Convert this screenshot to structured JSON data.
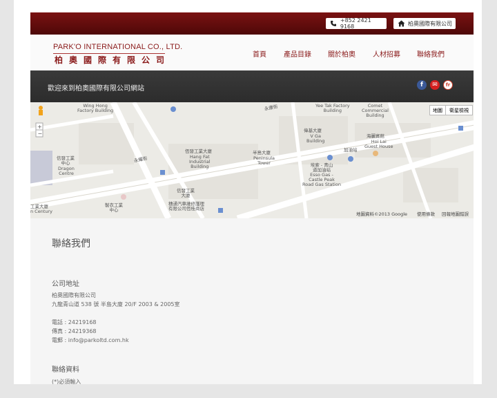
{
  "topbar": {
    "phone": "+852 2421 9168",
    "company": "柏奧國際有限公司",
    "phone_icon": "phone-icon",
    "home_icon": "home-icon"
  },
  "header": {
    "logo_en": "PARK'O INTERNATIONAL CO., LTD.",
    "logo_zh": "柏奧國際有限公司",
    "nav": [
      "首頁",
      "產品目錄",
      "關於柏奧",
      "人材招募",
      "聯絡我們"
    ]
  },
  "band": {
    "welcome": "歡迎來到柏奧國際有限公司網站",
    "social": [
      "f",
      "✉",
      "fr"
    ]
  },
  "map": {
    "type_map": "地圖",
    "type_sat": "衛星檢視",
    "street_main": "永耀街",
    "street_top": "永康街",
    "labels": {
      "wing_hong": "Wing Hong\nFactory Building",
      "hang_fat_zh": "恆發工業大廈",
      "hang_fat": "Hang Fat\nIndustrial\nBuilding",
      "peninsula_zh": "半島大廈",
      "peninsula": "Peninsula\nTower",
      "dragon_zh": "信發工業\n中心",
      "dragon": "Dragon\nCentre",
      "yee_tak": "Yee Tak Factory\nBuilding",
      "comet": "Comet\nCommercial\nBuilding",
      "vgo_zh": "偉基大廈",
      "vgo": "V Ga\nBuilding",
      "hoi_lai_zh": "海麗賓館",
      "hoi_lai": "Hoi Lai\nGuest House",
      "esso": "埃索 - 青山\n道加油站\nEsso Gas -\nCastle Peak\nRoad Gas Station",
      "petrol": "加油站",
      "factory_zh": "信發工業\n大廈",
      "bus": "穗通汽車維修護理\n有限公司恆桂商店",
      "pf_zh": "製衣工業\n中心",
      "left_bottom": "工業大廈\nn Century"
    },
    "footer_data": "地圖資料©2013 Google",
    "footer_terms": "使用條款",
    "footer_report": "回報地圖錯誤"
  },
  "contact": {
    "title": "聯絡我們",
    "address_title": "公司地址",
    "company": "柏奧國際有限公司",
    "address": "九龍青山道 538 號 半島大廈  20/F 2003 & 2005室",
    "tel": "電話 : 24219168",
    "fax": "傳真 : 24219368",
    "email": "電郵 : info@parkoltd.com.hk",
    "info_title": "聯絡資料",
    "required": "(*)必須輸入"
  },
  "colors": {
    "brand": "#8a1a1a",
    "dark_band": "#333333",
    "facebook": "#3b5998",
    "email": "#d42020",
    "other": "#d0402a"
  }
}
